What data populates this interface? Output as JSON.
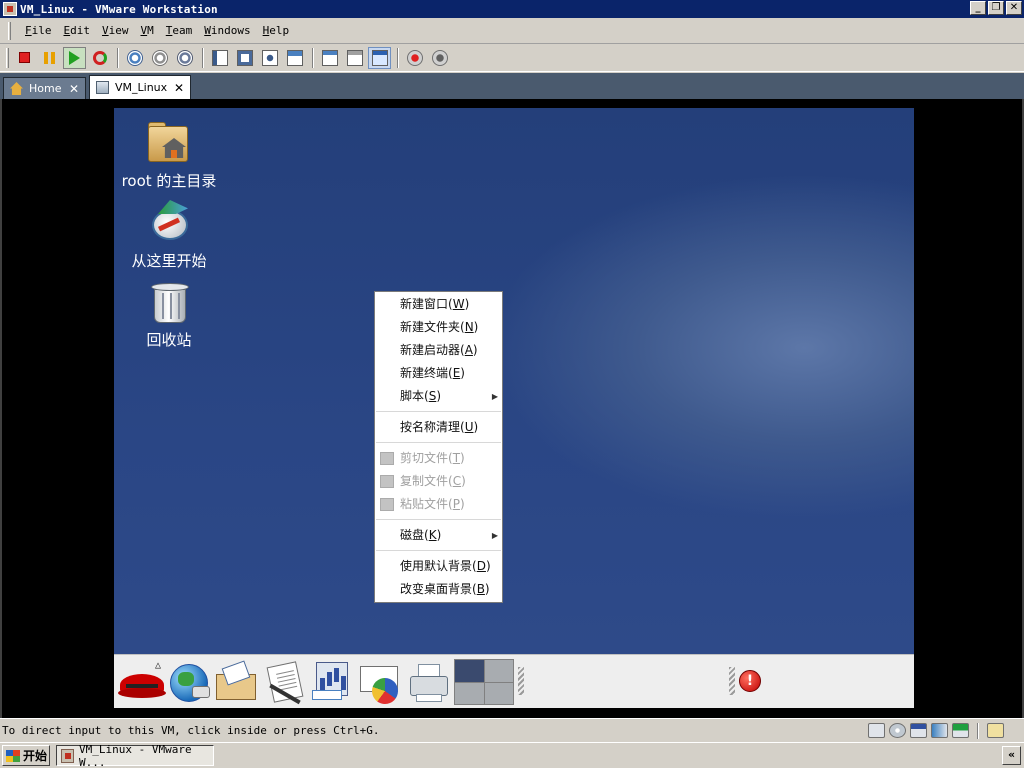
{
  "window": {
    "title": "VM_Linux - VMware Workstation",
    "controls": {
      "minimize": "_",
      "maximize": "❐",
      "close": "✕"
    }
  },
  "menu": {
    "items": [
      {
        "accel": "F",
        "rest": "ile"
      },
      {
        "accel": "E",
        "rest": "dit"
      },
      {
        "accel": "V",
        "rest": "iew"
      },
      {
        "accel": "V",
        "rest": "M"
      },
      {
        "accel": "T",
        "rest": "eam"
      },
      {
        "accel": "W",
        "rest": "indows"
      },
      {
        "accel": "H",
        "rest": "elp"
      }
    ]
  },
  "toolbar": {
    "icons": [
      "power-off-icon",
      "pause-icon",
      "power-on-icon",
      "reset-icon",
      "snapshot-take-icon",
      "snapshot-revert-icon",
      "snapshot-manager-icon",
      "quick-switch-icon",
      "full-screen-icon",
      "unity-icon",
      "summary-view-icon",
      "console-view-icon",
      "thumbnail-view-icon",
      "appliance-view-icon",
      "record-icon",
      "replay-icon"
    ]
  },
  "tabs": [
    {
      "label": "Home",
      "close": "✕"
    },
    {
      "label": "VM_Linux",
      "close": "✕"
    }
  ],
  "guest": {
    "desktop_icons": [
      {
        "label": "root 的主目录"
      },
      {
        "label": "从这里开始"
      },
      {
        "label": "回收站"
      }
    ],
    "context_menu": {
      "group1": [
        {
          "text": "新建窗口(",
          "accel": "W",
          "end": ")"
        },
        {
          "text": "新建文件夹(",
          "accel": "N",
          "end": ")"
        },
        {
          "text": "新建启动器(",
          "accel": "A",
          "end": ")"
        },
        {
          "text": "新建终端(",
          "accel": "E",
          "end": ")"
        },
        {
          "text": "脚本(",
          "accel": "S",
          "end": ")",
          "submenu": "▶"
        }
      ],
      "group2": [
        {
          "text": "按名称清理(",
          "accel": "U",
          "end": ")"
        }
      ],
      "group3": [
        {
          "text": "剪切文件(",
          "accel": "T",
          "end": ")"
        },
        {
          "text": "复制文件(",
          "accel": "C",
          "end": ")"
        },
        {
          "text": "粘贴文件(",
          "accel": "P",
          "end": ")"
        }
      ],
      "group4": [
        {
          "text": "磁盘(",
          "accel": "K",
          "end": ")",
          "submenu": "▶"
        }
      ],
      "group5": [
        {
          "text": "使用默认背景(",
          "accel": "D",
          "end": ")"
        },
        {
          "text": "改变桌面背景(",
          "accel": "B",
          "end": ")"
        }
      ]
    },
    "panel": {
      "menu_indicator": "△",
      "alert_symbol": "!"
    }
  },
  "statusbar": {
    "message": "To direct input to this VM, click inside or press Ctrl+G."
  },
  "taskbar": {
    "start_label": "开始",
    "task_label": "VM_Linux - VMware W...",
    "tray_arrow": "«"
  },
  "colors": {
    "titlebar": "#0a246a",
    "desktop": "#2a4685",
    "tabstrip": "#4a5a6e",
    "alert": "#c00000"
  }
}
